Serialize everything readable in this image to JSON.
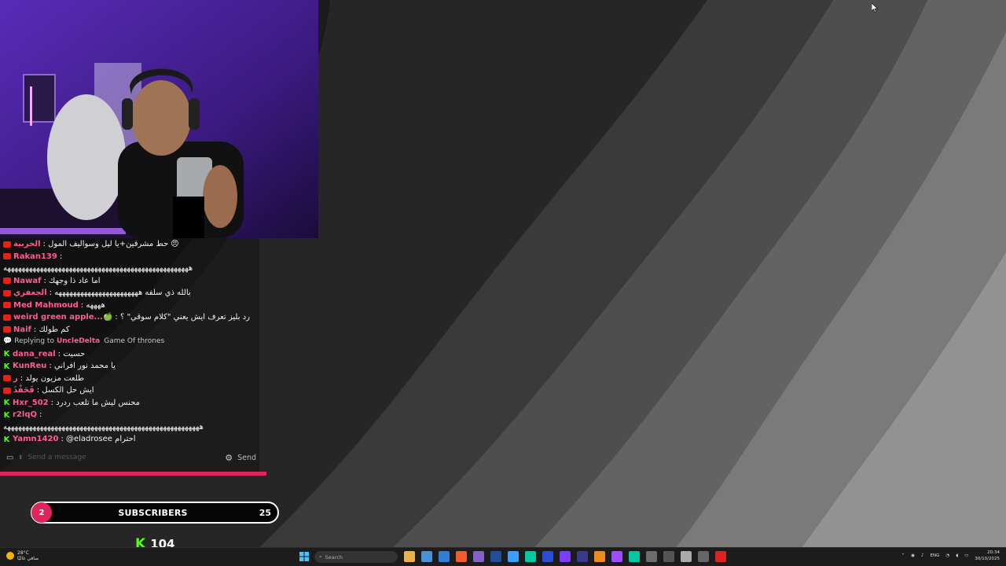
{
  "chat": {
    "messages": [
      {
        "badge": "yt",
        "user": "الحربية",
        "user_color": "pink",
        "text": ": حط مشرفين+يا ليل وسواليف المول 😠"
      },
      {
        "badge": "yt",
        "user": "Rakan139",
        "user_color": "pink",
        "text": ":"
      },
      {
        "badge": "",
        "user": "",
        "user_color": "",
        "text": "هههههههههههههههههههههههههههههههههههههههههههههههههههه"
      },
      {
        "badge": "yt",
        "user": "Nawaf",
        "user_color": "pink",
        "text": ": اما عاد ذا وجهك"
      },
      {
        "badge": "yt",
        "user": "الجعفري",
        "user_color": "pink",
        "text": ": بالله ذي سلفه هههههههههههههههههههههههه"
      },
      {
        "badge": "yt",
        "user": "Med Mahmoud",
        "user_color": "pink",
        "text": ": ههههه"
      },
      {
        "badge": "yt",
        "user": "weird green apple...🍏",
        "user_color": "pink",
        "text": ": رد بليز تعرف ايش يعني \"كلام سوقي\" ؟"
      },
      {
        "badge": "yt",
        "user": "Naif",
        "user_color": "pink",
        "text": ": كم طولك"
      },
      {
        "badge": "reply",
        "user": "UncleDelta",
        "user_color": "pink",
        "text": "Game Of thrones",
        "reply_prefix": "Replying to"
      },
      {
        "badge": "kick",
        "user": "dana_real",
        "user_color": "pink",
        "text": ": حسيت"
      },
      {
        "badge": "kick",
        "user": "KunReu",
        "user_color": "pink",
        "text": ": يا محمد نور افراني"
      },
      {
        "badge": "yt",
        "user": "ر",
        "user_color": "pink",
        "text": ": طلعت مزيون يولد"
      },
      {
        "badge": "yt",
        "user": "فَحَفْذَ",
        "user_color": "pink",
        "text": ": ايش حل الكسل"
      },
      {
        "badge": "kick",
        "user": "Hxr_502",
        "user_color": "pink",
        "text": ": محنس ليش ما تلعب ردرد"
      },
      {
        "badge": "kick",
        "user": "r2lqQ",
        "user_color": "pink",
        "text": ":"
      },
      {
        "badge": "",
        "user": "",
        "user_color": "",
        "text": "ههههههههههههههههههههههههههههههههههههههههههههههههههههههه"
      },
      {
        "badge": "kick",
        "user": "Yamn1420",
        "user_color": "pink",
        "text": ": @eladrosee احترام"
      }
    ],
    "input_placeholder": "Send a message",
    "send_label": "Send"
  },
  "subscribers": {
    "current": "2",
    "label": "SUBSCRIBERS",
    "goal": "25"
  },
  "kick_followers": "104",
  "taskbar": {
    "weather_temp": "28°C",
    "weather_desc": "صافي غالبًا",
    "search_placeholder": "Search",
    "lang": "ENG",
    "time": "20:34",
    "date": "30/10/2025",
    "apps": [
      "file-explorer",
      "store",
      "vscode",
      "brave",
      "visual-studio",
      "photoshop",
      "app",
      "audition",
      "media",
      "after-effects",
      "media-encoder",
      "blender",
      "premiere",
      "audition",
      "obs",
      "app",
      "app",
      "app",
      "obs-studio"
    ]
  },
  "colors": {
    "accent_pink": "#e0245e",
    "kick_green": "#53fc18",
    "youtube_red": "#e62117"
  }
}
